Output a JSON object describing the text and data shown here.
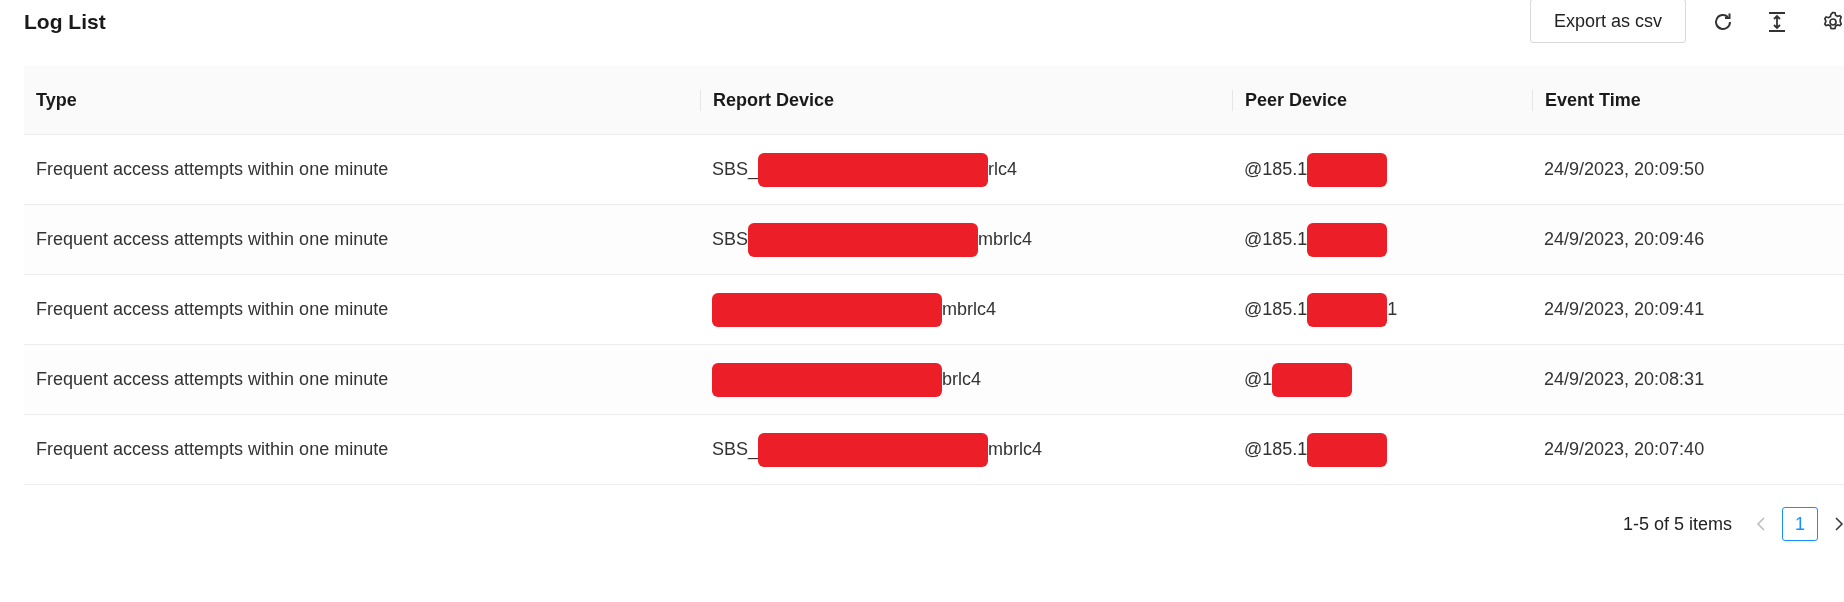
{
  "title": "Log List",
  "toolbar": {
    "export_button": "Export as csv"
  },
  "table": {
    "columns": [
      "Type",
      "Report Device",
      "Peer Device",
      "Event Time"
    ],
    "rows": [
      {
        "type": "Frequent access attempts within one minute",
        "report_device": {
          "start": "SBS_",
          "end": "rlc4",
          "redacted": true
        },
        "peer_device": {
          "start": "@185.1",
          "redacted": true
        },
        "event_time": "24/9/2023, 20:09:50"
      },
      {
        "type": "Frequent access attempts within one minute",
        "report_device": {
          "start": "SBS",
          "end": "mbrlc4",
          "redacted": true
        },
        "peer_device": {
          "start": "@185.1",
          "redacted": true
        },
        "event_time": "24/9/2023, 20:09:46"
      },
      {
        "type": "Frequent access attempts within one minute",
        "report_device": {
          "end": "mbrlc4",
          "redacted": true
        },
        "peer_device": {
          "start": "@185.1",
          "end": "1",
          "redacted": true
        },
        "event_time": "24/9/2023, 20:09:41"
      },
      {
        "type": "Frequent access attempts within one minute",
        "report_device": {
          "end": "brlc4",
          "redacted": true
        },
        "peer_device": {
          "start": "@1",
          "redacted": true
        },
        "event_time": "24/9/2023, 20:08:31"
      },
      {
        "type": "Frequent access attempts within one minute",
        "report_device": {
          "start": "SBS_",
          "end": "mbrlc4",
          "redacted": true
        },
        "peer_device": {
          "start": "@185.1",
          "redacted": true
        },
        "event_time": "24/9/2023, 20:07:40"
      }
    ]
  },
  "pagination": {
    "summary": "1-5 of 5 items",
    "prev_disabled": true,
    "pages": [
      {
        "label": "1",
        "selected": true
      }
    ]
  }
}
